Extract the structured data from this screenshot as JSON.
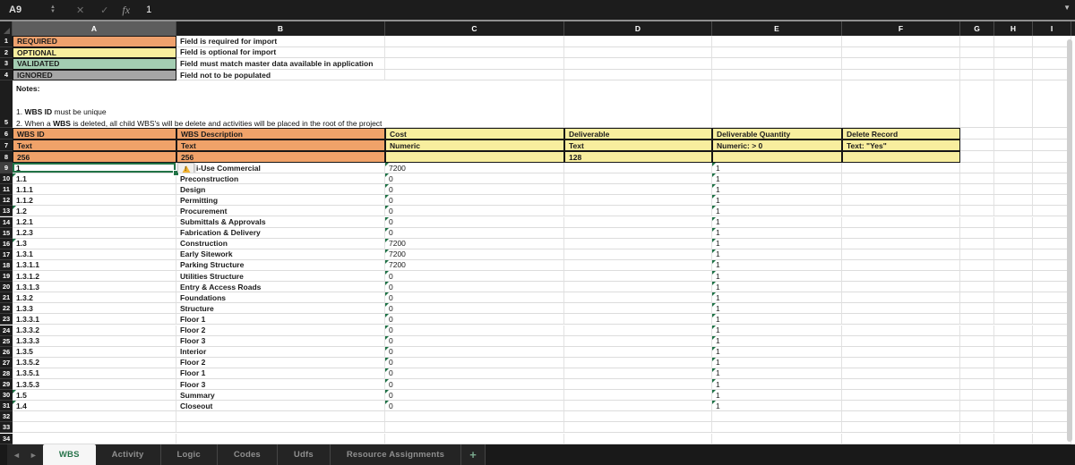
{
  "colors": {
    "accent_green": "#217346",
    "flag_green": "#1E7145",
    "required_fill": "#EFA16D",
    "optional_fill": "#F8EE9E",
    "validated_fill": "#A3CDB2",
    "ignored_fill": "#A6A6A6",
    "header_orange": "#F0A269",
    "header_yellow": "#F8EE9E"
  },
  "formula_bar": {
    "name_box": "A9",
    "fx_label": "fx",
    "value": "1",
    "cancel_icon": "✕",
    "enter_icon": "✓"
  },
  "column_letters": [
    "A",
    "B",
    "C",
    "D",
    "E",
    "F",
    "G",
    "H",
    "I"
  ],
  "legend": [
    {
      "label": "REQUIRED",
      "desc": "Field is required for import",
      "color": "#EFA16D"
    },
    {
      "label": "OPTIONAL",
      "desc": "Field is optional for import",
      "color": "#F8EE9E"
    },
    {
      "label": "VALIDATED",
      "desc": "Field must match master data available in application",
      "color": "#A3CDB2"
    },
    {
      "label": "IGNORED",
      "desc": "Field not to be populated",
      "color": "#A6A6A6"
    }
  ],
  "notes": {
    "title": "Notes:",
    "lines": [
      [
        {
          "t": "1. "
        },
        {
          "t": "WBS ID",
          "b": 1
        },
        {
          "t": " must be unique"
        }
      ],
      [
        {
          "t": "2. When a "
        },
        {
          "t": "WBS",
          "b": 1
        },
        {
          "t": " is deleted, all child WBS's will be delete and activities will be placed in the root of the project"
        }
      ]
    ]
  },
  "field_table": {
    "columns": [
      {
        "header": "WBS ID",
        "type": "Text",
        "limit": "256",
        "color": "orange"
      },
      {
        "header": "WBS Description",
        "type": "Text",
        "limit": "256",
        "color": "orange"
      },
      {
        "header": "Cost",
        "type": "Numeric",
        "limit": "",
        "color": "yellow"
      },
      {
        "header": "Deliverable",
        "type": "Text",
        "limit": "128",
        "color": "yellow"
      },
      {
        "header": "Deliverable Quantity",
        "type": "Numeric: > 0",
        "limit": "",
        "color": "yellow"
      },
      {
        "header": "Delete Record",
        "type": "Text: \"Yes\"",
        "limit": "",
        "color": "yellow"
      }
    ]
  },
  "wbs_rows": [
    {
      "row": 9,
      "id": "1",
      "desc": "i-Use Commercial",
      "cost": "7200",
      "qty": "1",
      "id_flag": true,
      "warning": true,
      "selected": true
    },
    {
      "row": 10,
      "id": "1.1",
      "desc": "Preconstruction",
      "cost": "0",
      "qty": "1",
      "id_flag": true
    },
    {
      "row": 11,
      "id": "1.1.1",
      "desc": "Design",
      "cost": "0",
      "qty": "1"
    },
    {
      "row": 12,
      "id": "1.1.2",
      "desc": "Permitting",
      "cost": "0",
      "qty": "1"
    },
    {
      "row": 13,
      "id": "1.2",
      "desc": "Procurement",
      "cost": "0",
      "qty": "1",
      "id_flag": true
    },
    {
      "row": 14,
      "id": "1.2.1",
      "desc": "Submittals & Approvals",
      "cost": "0",
      "qty": "1"
    },
    {
      "row": 15,
      "id": "1.2.3",
      "desc": "Fabrication & Delivery",
      "cost": "0",
      "qty": "1"
    },
    {
      "row": 16,
      "id": "1.3",
      "desc": "Construction",
      "cost": "7200",
      "qty": "1",
      "id_flag": true
    },
    {
      "row": 17,
      "id": "1.3.1",
      "desc": "Early Sitework",
      "cost": "7200",
      "qty": "1"
    },
    {
      "row": 18,
      "id": "1.3.1.1",
      "desc": "Parking Structure",
      "cost": "7200",
      "qty": "1"
    },
    {
      "row": 19,
      "id": "1.3.1.2",
      "desc": "Utilities Structure",
      "cost": "0",
      "qty": "1"
    },
    {
      "row": 20,
      "id": "1.3.1.3",
      "desc": "Entry & Access Roads",
      "cost": "0",
      "qty": "1"
    },
    {
      "row": 21,
      "id": "1.3.2",
      "desc": "Foundations",
      "cost": "0",
      "qty": "1"
    },
    {
      "row": 22,
      "id": "1.3.3",
      "desc": "Structure",
      "cost": "0",
      "qty": "1"
    },
    {
      "row": 23,
      "id": "1.3.3.1",
      "desc": "Floor 1",
      "cost": "0",
      "qty": "1"
    },
    {
      "row": 24,
      "id": "1.3.3.2",
      "desc": "Floor 2",
      "cost": "0",
      "qty": "1"
    },
    {
      "row": 25,
      "id": "1.3.3.3",
      "desc": "Floor 3",
      "cost": "0",
      "qty": "1"
    },
    {
      "row": 26,
      "id": "1.3.5",
      "desc": "Interior",
      "cost": "0",
      "qty": "1"
    },
    {
      "row": 27,
      "id": "1.3.5.2",
      "desc": "Floor 2",
      "cost": "0",
      "qty": "1"
    },
    {
      "row": 28,
      "id": "1.3.5.1",
      "desc": "Floor 1",
      "cost": "0",
      "qty": "1"
    },
    {
      "row": 29,
      "id": "1.3.5.3",
      "desc": "Floor 3",
      "cost": "0",
      "qty": "1"
    },
    {
      "row": 30,
      "id": "1.5",
      "desc": "Summary",
      "cost": "0",
      "qty": "1",
      "id_flag": true
    },
    {
      "row": 31,
      "id": "1.4",
      "desc": "Closeout",
      "cost": "0",
      "qty": "1",
      "id_flag": true
    }
  ],
  "empty_rows": [
    32,
    33,
    34
  ],
  "tabs": {
    "items": [
      {
        "label": "WBS",
        "active": true
      },
      {
        "label": "Activity"
      },
      {
        "label": "Logic"
      },
      {
        "label": "Codes"
      },
      {
        "label": "Udfs"
      },
      {
        "label": "Resource Assignments"
      }
    ],
    "add_label": "+",
    "prev_icon": "◄",
    "next_icon": "►"
  }
}
